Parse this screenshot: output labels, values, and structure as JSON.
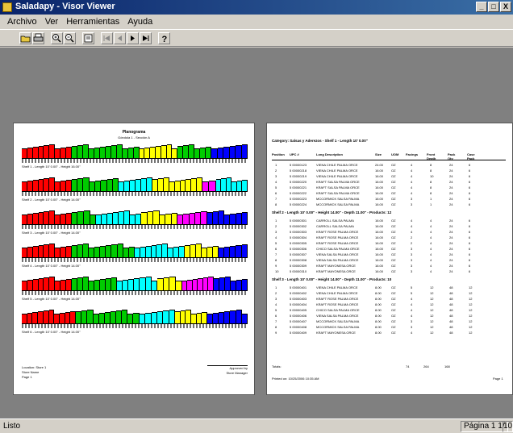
{
  "window": {
    "title": "Saladapy - Visor Viewer",
    "min": "_",
    "max": "□",
    "close": "X"
  },
  "menu": [
    "Archivo",
    "Ver",
    "Herramientas",
    "Ayuda"
  ],
  "toolbar": {
    "icons": [
      "open-icon",
      "print-icon",
      "zoom-in-icon",
      "zoom-out-icon",
      "export-icon",
      "first-page-icon",
      "prev-page-icon",
      "next-page-icon",
      "last-page-icon",
      "help-icon"
    ]
  },
  "statusbar": {
    "left": "Listo",
    "page": "Página 1",
    "of": "1/",
    "zoom": "100"
  },
  "left_page": {
    "title": "Planograma",
    "subtitle": "Góndola 1 - Sección A",
    "shelves": [
      {
        "caption": "Shelf 1 - Length 10' 0.00\" - Height 16.00\"",
        "colors": [
          "#ff0000",
          "#00cc00",
          "#ffff00",
          "#00cc00",
          "#0000ff"
        ],
        "widths": [
          0.22,
          0.3,
          0.17,
          0.15,
          0.16
        ]
      },
      {
        "caption": "Shelf 2 - Length 10' 0.00\" - Height 14.00\"",
        "colors": [
          "#ff0000",
          "#00cc00",
          "#00ffff",
          "#ffff00",
          "#ff00ff",
          "#00ffff"
        ],
        "widths": [
          0.22,
          0.21,
          0.15,
          0.22,
          0.06,
          0.14
        ]
      },
      {
        "caption": "Shelf 3 - Length 10' 0.00\" - Height 14.00\"",
        "colors": [
          "#ff0000",
          "#00cc00",
          "#00ffff",
          "#ffff00",
          "#ff00ff",
          "#0000ff"
        ],
        "widths": [
          0.22,
          0.11,
          0.2,
          0.16,
          0.13,
          0.18
        ]
      },
      {
        "caption": "Shelf 4 - Length 10' 0.00\" - Height 14.00\"",
        "colors": [
          "#ff0000",
          "#00cc00",
          "#00ffff",
          "#ffff00",
          "#0000ff"
        ],
        "widths": [
          0.22,
          0.28,
          0.22,
          0.15,
          0.13
        ]
      },
      {
        "caption": "Shelf 5 - Length 10' 0.00\" - Height 14.00\"",
        "colors": [
          "#ff0000",
          "#00cc00",
          "#00ffff",
          "#ffff00",
          "#ff00ff",
          "#0000ff"
        ],
        "widths": [
          0.22,
          0.2,
          0.18,
          0.11,
          0.14,
          0.15
        ]
      },
      {
        "caption": "Shelf 6 - Length 10' 0.00\" - Height 14.00\"",
        "colors": [
          "#ff0000",
          "#00cc00",
          "#00ffff",
          "#ffff00",
          "#0000ff"
        ],
        "widths": [
          0.24,
          0.28,
          0.16,
          0.14,
          0.18
        ]
      }
    ],
    "footer_left": [
      "Location: Store 1",
      "Store Name",
      "Page 1"
    ],
    "footer_right": [
      "Approved by",
      "Store Manager"
    ]
  },
  "right_page": {
    "heading": "Category: Salsas y Aderezos - Shelf 1 - Length 10' 0.00\"",
    "columns": [
      "Position",
      "UPC #",
      "Long Description",
      "Size",
      "UOM",
      "Facings",
      "Front Depth",
      "Pack Qty",
      "Case Pack"
    ],
    "shelves": [
      {
        "label": "",
        "rows": [
          [
            "1",
            "5 00000123",
            "VIENA CHILE PALMA ORCE",
            "24.00",
            "OZ",
            "4",
            "8",
            "24",
            "6"
          ],
          [
            "2",
            "5 00000218",
            "VIENA CHILE PALMA ORCE",
            "16.00",
            "OZ",
            "4",
            "8",
            "24",
            "6"
          ],
          [
            "3",
            "5 00000219",
            "VIENA CHILE PALMA ORCE",
            "16.00",
            "OZ",
            "4",
            "10",
            "24",
            "6"
          ],
          [
            "4",
            "5 00000220",
            "KRAFT SALSA PALMA ORCE",
            "16.00",
            "OZ",
            "4",
            "8",
            "24",
            "6"
          ],
          [
            "5",
            "5 00000221",
            "KRAFT SALSA PALMA ORCE",
            "16.00",
            "OZ",
            "4",
            "8",
            "24",
            "6"
          ],
          [
            "6",
            "5 00000222",
            "KRAFT SALSA PALMA ORCE",
            "16.00",
            "OZ",
            "4",
            "8",
            "24",
            "6"
          ],
          [
            "7",
            "5 00000223",
            "MCCORMICK SALSA PALMA",
            "16.00",
            "OZ",
            "3",
            "1",
            "24",
            "6"
          ],
          [
            "8",
            "5 00000224",
            "MCCORMICK SALSA PALMA",
            "16.00",
            "OZ",
            "3",
            "1",
            "24",
            "6"
          ]
        ]
      },
      {
        "label": "Shelf 2 - Length 10' 0.00\" - Height 14.00\" - Depth 11.00\" - Products: 12",
        "rows": [
          [
            "1",
            "5 00000301",
            "CARROLL SALSA PALMA",
            "16.00",
            "OZ",
            "4",
            "4",
            "24",
            "6"
          ],
          [
            "2",
            "5 00000302",
            "CARROLL SALSA PALMA",
            "16.00",
            "OZ",
            "4",
            "4",
            "24",
            "6"
          ],
          [
            "3",
            "5 00000303",
            "KRAFT ROSE PALMA ORCE",
            "16.00",
            "OZ",
            "4",
            "4",
            "24",
            "6"
          ],
          [
            "4",
            "5 00000304",
            "KRAFT ROSE PALMA ORCE",
            "16.00",
            "OZ",
            "2",
            "4",
            "24",
            "6"
          ],
          [
            "5",
            "5 00000305",
            "KRAFT ROSE PALMA ORCE",
            "16.00",
            "OZ",
            "2",
            "4",
            "24",
            "6"
          ],
          [
            "6",
            "5 00000306",
            "CHICO SALSA PALMA ORCE",
            "16.00",
            "OZ",
            "3",
            "4",
            "24",
            "6"
          ],
          [
            "7",
            "5 00000307",
            "VIENA SALSA PALMA ORCE",
            "16.00",
            "OZ",
            "3",
            "4",
            "24",
            "6"
          ],
          [
            "8",
            "5 00000308",
            "VIENA SALSA PALMA ORCE",
            "16.00",
            "OZ",
            "3",
            "4",
            "24",
            "6"
          ],
          [
            "9",
            "5 00000309",
            "KRAFT MAYONESA ORCE",
            "16.00",
            "OZ",
            "3",
            "4",
            "24",
            "6"
          ],
          [
            "10",
            "5 00000310",
            "KRAFT MAYONESA ORCE",
            "16.00",
            "OZ",
            "3",
            "4",
            "24",
            "6"
          ]
        ]
      },
      {
        "label": "Shelf 3 - Length 10' 0.00\" - Height 14.00\" - Depth 11.00\" - Products: 10",
        "rows": [
          [
            "1",
            "5 00000401",
            "VIENA CHILE PALMA ORCE",
            "8.00",
            "OZ",
            "5",
            "12",
            "48",
            "12"
          ],
          [
            "2",
            "5 00000402",
            "VIENA CHILE PALMA ORCE",
            "8.00",
            "OZ",
            "5",
            "12",
            "48",
            "12"
          ],
          [
            "3",
            "5 00000403",
            "KRAFT ROSE PALMA ORCE",
            "8.00",
            "OZ",
            "4",
            "12",
            "48",
            "12"
          ],
          [
            "4",
            "5 00000404",
            "KRAFT ROSE PALMA ORCE",
            "8.00",
            "OZ",
            "4",
            "12",
            "48",
            "12"
          ],
          [
            "5",
            "5 00000405",
            "CHICO SALSA PALMA ORCE",
            "8.00",
            "OZ",
            "4",
            "12",
            "48",
            "12"
          ],
          [
            "6",
            "5 00000406",
            "VIENA SALSA PALMA ORCE",
            "8.00",
            "OZ",
            "4",
            "12",
            "48",
            "12"
          ],
          [
            "7",
            "5 00000407",
            "MCCORMICK SALSA PALMA",
            "8.00",
            "OZ",
            "3",
            "12",
            "48",
            "12"
          ],
          [
            "8",
            "5 00000408",
            "MCCORMICK SALSA PALMA",
            "8.00",
            "OZ",
            "3",
            "12",
            "48",
            "12"
          ],
          [
            "9",
            "5 00000409",
            "KRAFT MAYONESA ORCE",
            "8.00",
            "OZ",
            "4",
            "12",
            "48",
            "12"
          ]
        ]
      }
    ],
    "totals": [
      "Totals:",
      "74",
      "264",
      "168"
    ],
    "footer_left": "Printed on: 10/25/2006 10:35 AM",
    "footer_right": "Page 1"
  }
}
